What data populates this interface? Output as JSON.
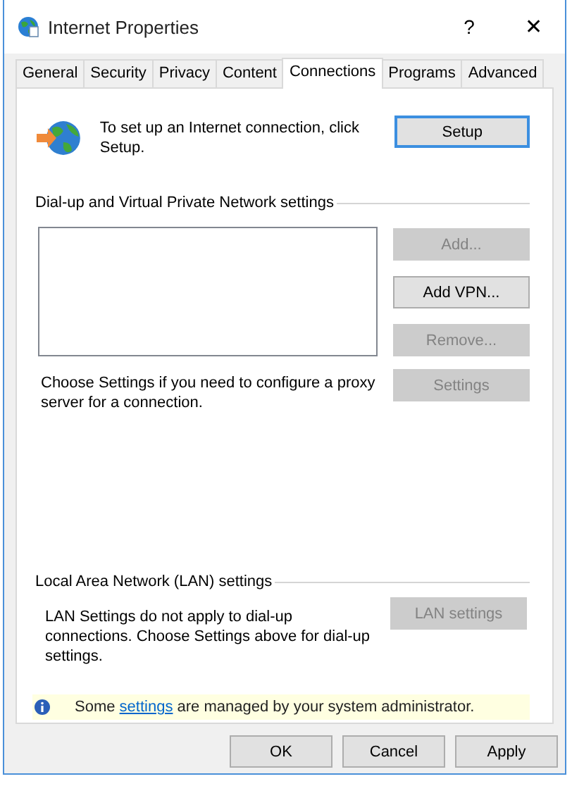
{
  "window": {
    "title": "Internet Properties",
    "help": "?",
    "close": "✕"
  },
  "tabs": [
    {
      "label": "General",
      "selected": false
    },
    {
      "label": "Security",
      "selected": false
    },
    {
      "label": "Privacy",
      "selected": false
    },
    {
      "label": "Content",
      "selected": false
    },
    {
      "label": "Connections",
      "selected": true
    },
    {
      "label": "Programs",
      "selected": false
    },
    {
      "label": "Advanced",
      "selected": false
    }
  ],
  "setup": {
    "text": "To set up an Internet connection, click Setup.",
    "button": {
      "label": "Setup",
      "default": true,
      "disabled": false
    }
  },
  "dialup": {
    "heading": "Dial-up and Virtual Private Network settings",
    "buttons": [
      {
        "label": "Add...",
        "disabled": true
      },
      {
        "label": "Add VPN...",
        "disabled": false
      },
      {
        "label": "Remove...",
        "disabled": true
      }
    ],
    "proxy_text": "Choose Settings if you need to configure a proxy server for a connection.",
    "settings_button": {
      "label": "Settings",
      "disabled": true
    }
  },
  "lan": {
    "heading": "Local Area Network (LAN) settings",
    "text": "LAN Settings do not apply to dial-up connections. Choose Settings above for dial-up settings.",
    "button": {
      "label": "LAN settings",
      "disabled": true
    }
  },
  "info": {
    "before": "Some ",
    "link": "settings",
    "after": " are managed by your system administrator."
  },
  "footer_buttons": [
    {
      "label": "OK",
      "disabled": false
    },
    {
      "label": "Cancel",
      "disabled": false
    },
    {
      "label": "Apply",
      "disabled": false
    }
  ]
}
